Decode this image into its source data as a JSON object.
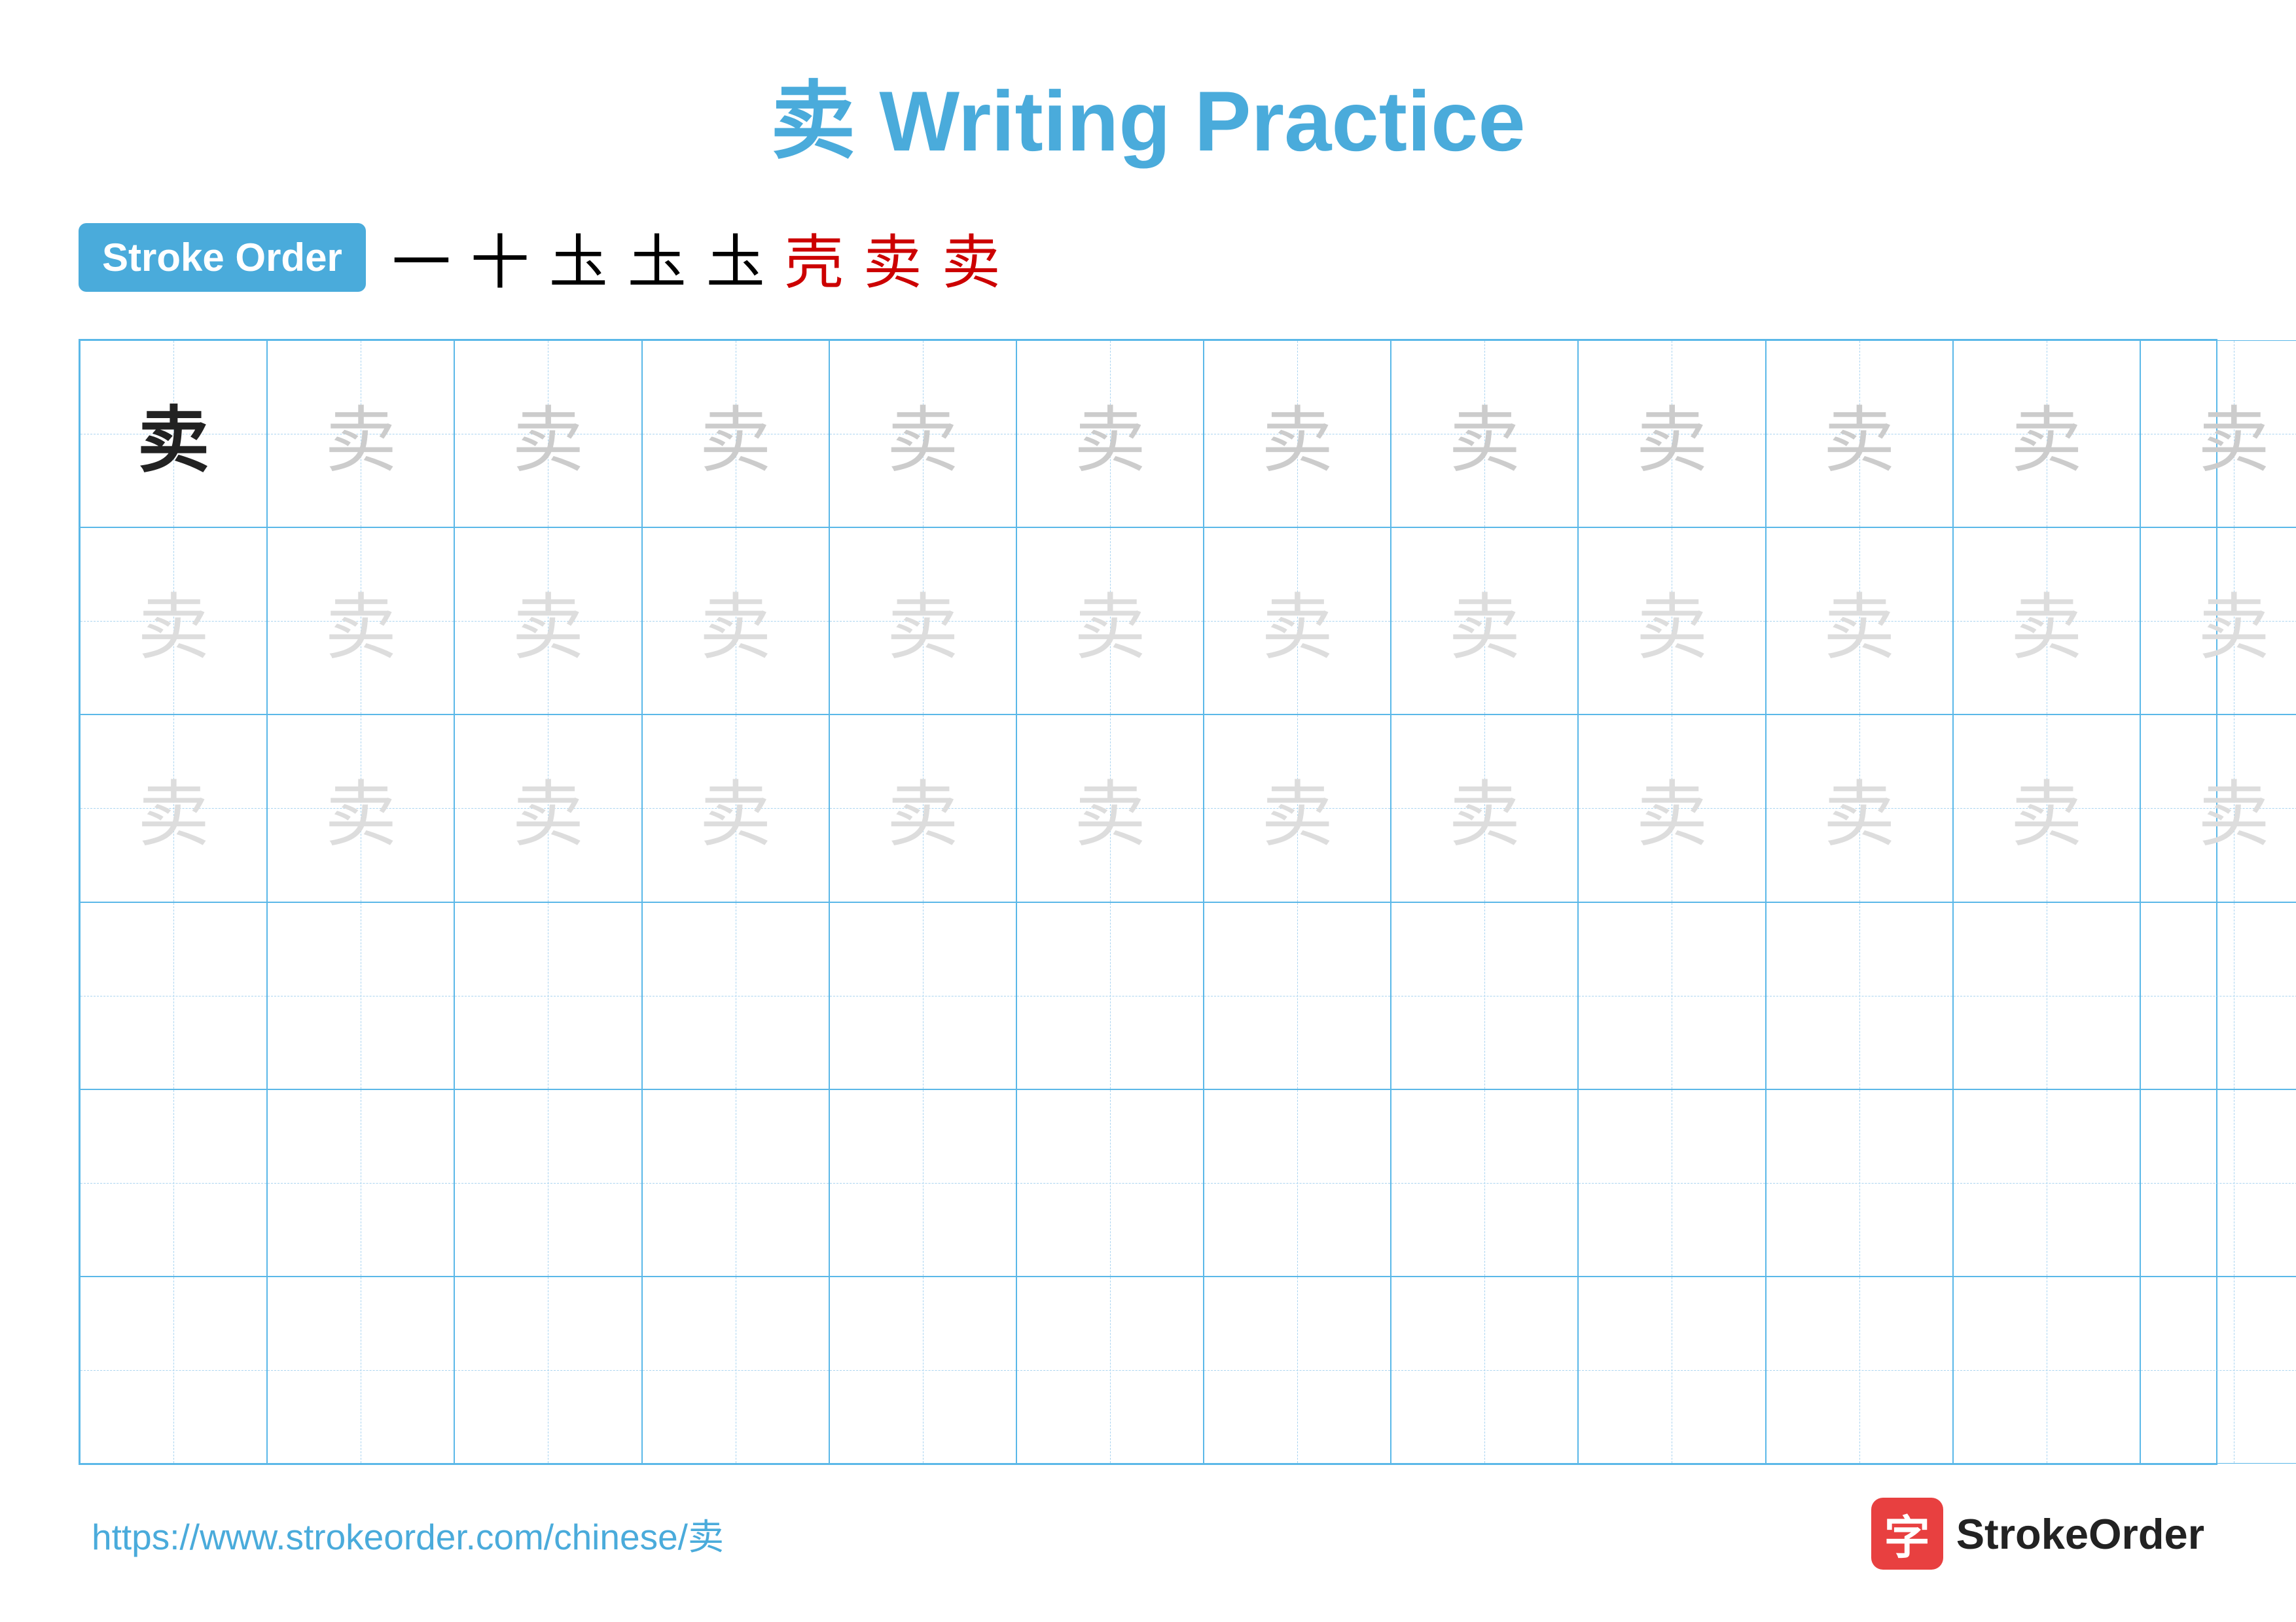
{
  "title": "卖 Writing Practice",
  "stroke_order": {
    "badge_label": "Stroke Order",
    "strokes": [
      {
        "char": "一",
        "style": "black"
      },
      {
        "char": "十",
        "style": "black"
      },
      {
        "char": "圡",
        "style": "black"
      },
      {
        "char": "圡",
        "style": "black"
      },
      {
        "char": "圡",
        "style": "black"
      },
      {
        "char": "壳",
        "style": "red"
      },
      {
        "char": "卖",
        "style": "red"
      },
      {
        "char": "卖",
        "style": "red"
      }
    ]
  },
  "grid": {
    "cols": 13,
    "rows": 6,
    "char": "卖",
    "dark_cell": {
      "row": 0,
      "col": 0
    },
    "light_rows": [
      0,
      1,
      2
    ],
    "empty_rows": [
      3,
      4,
      5
    ]
  },
  "footer": {
    "url": "https://www.strokeorder.com/chinese/卖",
    "logo_char": "字",
    "logo_text": "StrokeOrder"
  }
}
